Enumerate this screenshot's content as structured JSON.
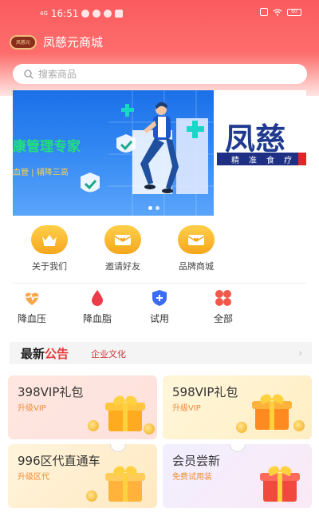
{
  "status_bar": {
    "signal": "4G",
    "time": "16:51",
    "battery": "60"
  },
  "header": {
    "logo_text": "凤慈元",
    "title": "凤慈元商城"
  },
  "search": {
    "placeholder": "搜索商品"
  },
  "banner": {
    "headline": "康管理专家",
    "subline": "血管 | 辅降三高",
    "brand": "凤慈",
    "strip": [
      "精",
      "准",
      "食",
      "疗"
    ]
  },
  "quick_entries": [
    {
      "label": "关于我们",
      "icon": "crown-icon"
    },
    {
      "label": "邀请好友",
      "icon": "envelope-heart-icon"
    },
    {
      "label": "品牌商城",
      "icon": "envelope-heart-icon"
    }
  ],
  "categories": [
    {
      "label": "降血压",
      "icon": "heart-pulse-icon",
      "color": "#f7a64a"
    },
    {
      "label": "降血脂",
      "icon": "blood-drop-icon",
      "color": "#ee3b4a"
    },
    {
      "label": "试用",
      "icon": "shield-plus-icon",
      "color": "#3b6cf3"
    },
    {
      "label": "全部",
      "icon": "four-petal-icon",
      "color": "#ef5a4a"
    }
  ],
  "notice": {
    "title_a": "最新",
    "title_b": "公告",
    "text": "企业文化"
  },
  "promo_cards": [
    {
      "title": "398VIP礼包",
      "sub": "升级VIP"
    },
    {
      "title": "598VIP礼包",
      "sub": "升级VIP"
    },
    {
      "title": "996区代直通车",
      "sub": "升级区代"
    },
    {
      "title": "会员尝新",
      "sub": "免费试用装"
    }
  ],
  "colors": {
    "header_red": "#fb5b5f",
    "accent_gold": "#f5a71c",
    "banner_blue": "#1c70e8",
    "notice_red": "#e93a3a"
  }
}
